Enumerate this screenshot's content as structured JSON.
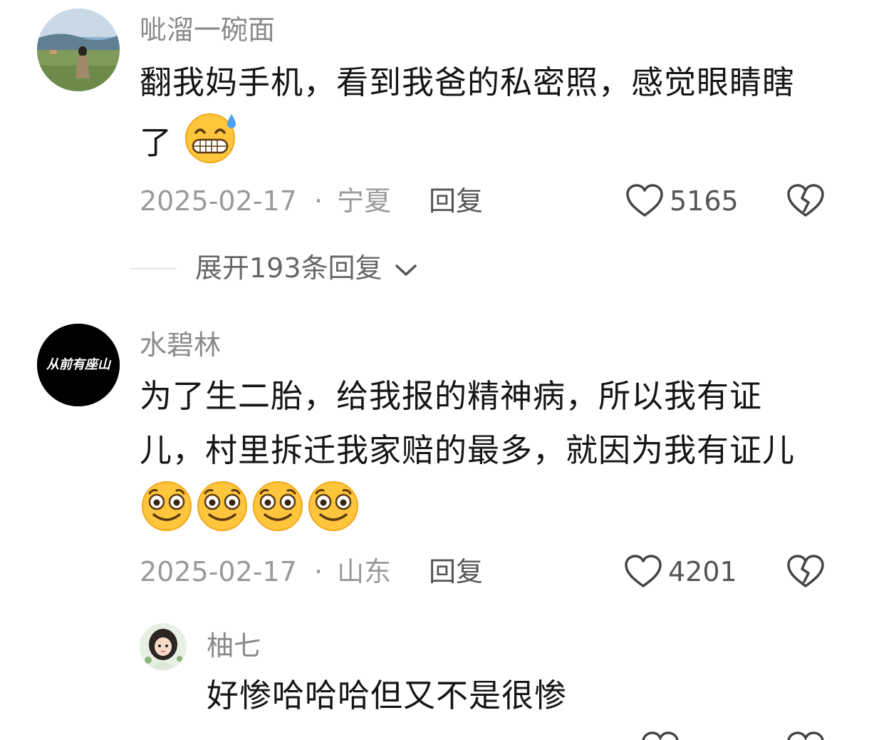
{
  "comments": [
    {
      "username": "呲溜一碗面",
      "text_line1": "翻我妈手机，看到我爸的私密照，感觉眼睛瞎",
      "text_line2": "了",
      "date": "2025-02-17",
      "sep": "·",
      "location": "宁夏",
      "reply_label": "回复",
      "likes": "5165",
      "expand_label": "展开193条回复",
      "emoji": "grin-sweat-emoji"
    },
    {
      "username": "水碧林",
      "avatar_text": "从前有座山",
      "text_line1": "为了生二胎，给我报的精神病，所以我有证",
      "text_line2": "儿，村里拆迁我家赔的最多，就因为我有证儿",
      "date": "2025-02-17",
      "sep": "·",
      "location": "山东",
      "reply_label": "回复",
      "likes": "4201",
      "emoji": "smile-emoji"
    }
  ],
  "sub_reply": {
    "username": "柚七",
    "text": "好惨哈哈哈但又不是很惨"
  }
}
